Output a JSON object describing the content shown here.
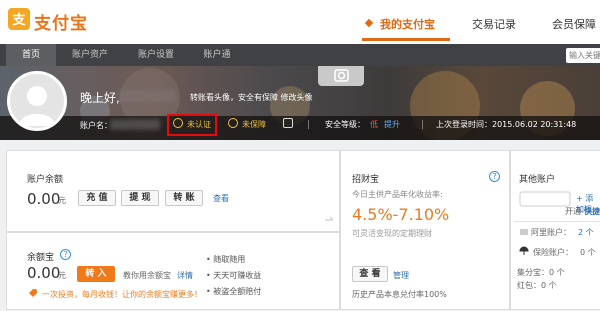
{
  "header": {
    "logo_text": "支付宝",
    "nav": [
      "我的支付宝",
      "交易记录",
      "会员保障"
    ]
  },
  "subnav": {
    "items": [
      "首页",
      "账户资产",
      "账户设置",
      "账户通"
    ],
    "search_placeholder": "输入关键"
  },
  "banner": {
    "greeting": "晚上好,",
    "avatar_link": "转账看头像，安全有保障 修改头像",
    "username_label": "账户名：",
    "unverified": "未认证",
    "unprotected": "未保障",
    "security_label": "安全等级：",
    "security_level": "低",
    "security_upgrade": "提升",
    "last_login": "上次登录时间：2015.06.02 20:31:48"
  },
  "balance": {
    "title": "账户余额",
    "amount": "0.00",
    "unit": "元",
    "recharge": "充 值",
    "withdraw": "提 现",
    "transfer": "转 账",
    "view": "查看"
  },
  "yuebao": {
    "title": "余额宝",
    "amount": "0.00",
    "unit": "元",
    "transfer_in": "转 入",
    "tip": "教你用余额宝",
    "detail": "详情",
    "features": [
      "随取随用",
      "天天可赚收益",
      "被盗全额赔付"
    ],
    "promo": "一次投资，每月收钱！让你的余额宝赚更多！"
  },
  "zhaocaibao": {
    "title": "招财宝",
    "rate_label": "今日主供产品年化收益率:",
    "rate": "4.5%-7.10%",
    "desc": "可灵活变现的定期理财",
    "view": "查 看",
    "manage": "管理",
    "history": "历史产品本息兑付率100%"
  },
  "other": {
    "title": "其他账户",
    "add": "+ 添加银",
    "open": "开通",
    "open_brand": "快捷",
    "ali_label": "阿里账户：",
    "ali_count": "2 个",
    "insurance_label": "保险账户：",
    "insurance_count": "0 个",
    "jifen": "集分宝：0 个",
    "hongbao": "红包：0 个"
  },
  "colors": {
    "brand_orange": "#e06a14",
    "highlight_red": "#e30b0b",
    "link_blue": "#2b6fb5"
  }
}
